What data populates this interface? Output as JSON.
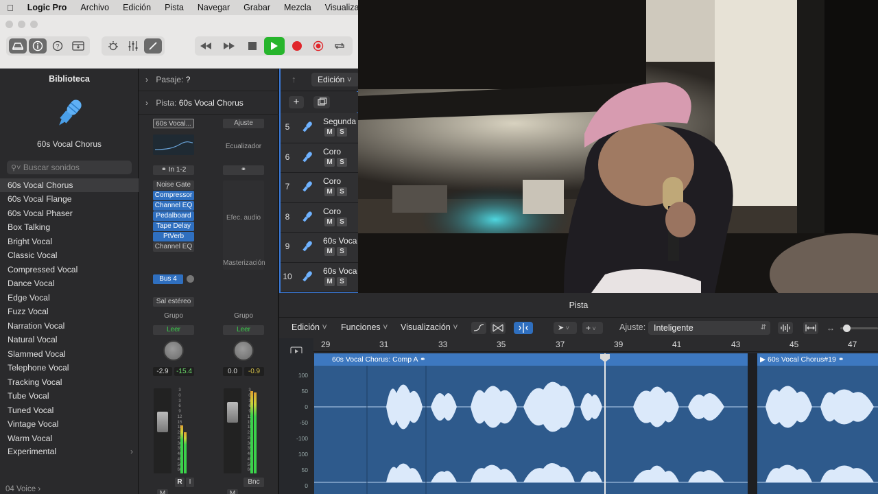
{
  "menubar": {
    "apple": "",
    "app": "Logic Pro",
    "items": [
      "Archivo",
      "Edición",
      "Pista",
      "Navegar",
      "Grabar",
      "Mezcla",
      "Visualizació"
    ]
  },
  "library": {
    "title": "Biblioteca",
    "selected_patch": "60s Vocal Chorus",
    "search_placeholder": "Buscar sonidos",
    "items": [
      "60s Vocal Chorus",
      "60s Vocal Flange",
      "60s Vocal Phaser",
      "Box Talking",
      "Bright Vocal",
      "Classic Vocal",
      "Compressed Vocal",
      "Dance Vocal",
      "Edge Vocal",
      "Fuzz Vocal",
      "Narration Vocal",
      "Natural Vocal",
      "Slammed Vocal",
      "Telephone Vocal",
      "Tracking Vocal",
      "Tube Vocal",
      "Tuned Vocal",
      "Vintage Vocal",
      "Warm Vocal",
      "Experimental"
    ],
    "footer": "04 Voice"
  },
  "inspector": {
    "region_label": "Pasaje:",
    "region_value": "?",
    "track_label": "Pista:",
    "track_value": "60s Vocal Chorus",
    "setting_left": "60s Vocal...",
    "setting_right": "Ajuste",
    "eq_right": "Ecualizador",
    "input": "In 1-2",
    "plugins": [
      "Noise Gate",
      "Compressor",
      "Channel EQ",
      "Pedalboard",
      "Tape Delay",
      "PtVerb",
      "Channel EQ"
    ],
    "plugin_states": [
      false,
      true,
      true,
      true,
      true,
      true,
      false
    ],
    "audio_fx_right": "Efec. audio",
    "mastering_right": "Masterización",
    "send": "Bus 4",
    "output": "Sal estéreo",
    "group_left": "Grupo",
    "group_right": "Grupo",
    "automation_left": "Leer",
    "automation_right": "Leer",
    "pan_left_a": "-2.9",
    "pan_left_b": "-15.4",
    "pan_right_a": "0.0",
    "pan_right_b": "-0.9",
    "bottom_r": "R",
    "bottom_i": "I",
    "bottom_bnc": "Bnc",
    "m_left": "M",
    "m_right": "M",
    "scale": [
      "3",
      "0",
      "3",
      "6",
      "9",
      "12",
      "15",
      "18",
      "21",
      "24",
      "30",
      "35",
      "40",
      "45",
      "50",
      "60"
    ]
  },
  "tracks_header": {
    "edit_menu": "Edición"
  },
  "tracks": [
    {
      "num": "5",
      "name": "Segunda"
    },
    {
      "num": "6",
      "name": "Coro"
    },
    {
      "num": "7",
      "name": "Coro"
    },
    {
      "num": "8",
      "name": "Coro"
    },
    {
      "num": "9",
      "name": "60s Voca"
    },
    {
      "num": "10",
      "name": "60s Voca"
    }
  ],
  "track_buttons": {
    "mute": "M",
    "solo": "S"
  },
  "editor": {
    "title": "Pista",
    "menus": [
      "Edición",
      "Funciones",
      "Visualización"
    ],
    "snap_label": "Ajuste:",
    "snap_value": "Inteligente",
    "ruler": [
      "29",
      "31",
      "33",
      "35",
      "37",
      "39",
      "41",
      "43",
      "45",
      "47"
    ],
    "region_a": "60s Vocal Chorus: Comp A",
    "region_b": "60s Vocal Chorus#19",
    "yaxis": [
      "100",
      "50",
      "0",
      "-50",
      "-100",
      "100",
      "50",
      "0"
    ]
  },
  "colors": {
    "accent": "#2f6fbf",
    "region": "#2e5a8c",
    "play": "#27b52c",
    "record": "#e0262b"
  }
}
